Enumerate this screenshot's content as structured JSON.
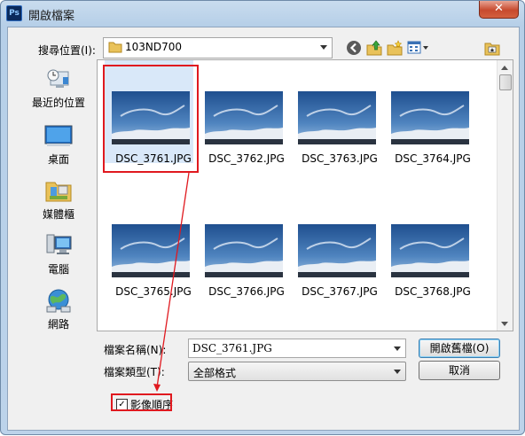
{
  "window": {
    "title": "開啟檔案",
    "app_icon_text": "Ps",
    "close_glyph": "✕"
  },
  "lookin": {
    "label": "搜尋位置(I):",
    "value": "103ND700"
  },
  "toolbar": {
    "icons": [
      "back-icon",
      "up-folder-icon",
      "new-folder-icon",
      "view-menu-icon",
      "photoshop-preview-icon"
    ]
  },
  "places": [
    {
      "label": "最近的位置",
      "icon": "recent-places-icon"
    },
    {
      "label": "桌面",
      "icon": "desktop-icon"
    },
    {
      "label": "媒體櫃",
      "icon": "libraries-icon"
    },
    {
      "label": "電腦",
      "icon": "computer-icon"
    },
    {
      "label": "網路",
      "icon": "network-icon"
    }
  ],
  "files": [
    {
      "name": "DSC_3761.JPG",
      "selected": true
    },
    {
      "name": "DSC_3762.JPG",
      "selected": false
    },
    {
      "name": "DSC_3763.JPG",
      "selected": false
    },
    {
      "name": "DSC_3764.JPG",
      "selected": false
    },
    {
      "name": "DSC_3765.JPG",
      "selected": false
    },
    {
      "name": "DSC_3766.JPG",
      "selected": false
    },
    {
      "name": "DSC_3767.JPG",
      "selected": false
    },
    {
      "name": "DSC_3768.JPG",
      "selected": false
    }
  ],
  "filename": {
    "label": "檔案名稱(N):",
    "value": "DSC_3761.JPG"
  },
  "filetype": {
    "label": "檔案類型(T):",
    "value": "全部格式"
  },
  "buttons": {
    "open": "開啟舊檔(O)",
    "cancel": "取消"
  },
  "image_sequence": {
    "label": "影像順序",
    "checked": true,
    "check_glyph": "✓"
  },
  "colors": {
    "annotation": "#e0191f",
    "selection": "#d9e8f9",
    "title_bar": "#b6cfe8"
  }
}
